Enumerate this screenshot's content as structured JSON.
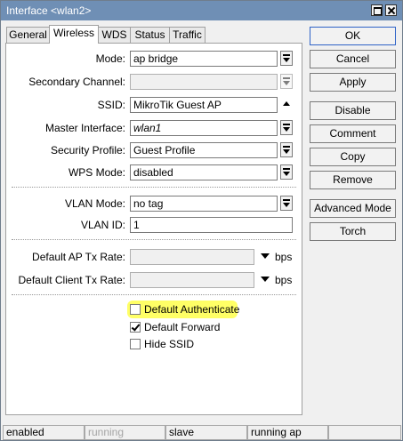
{
  "window": {
    "title": "Interface <wlan2>"
  },
  "tabs": [
    "General",
    "Wireless",
    "WDS",
    "Status",
    "Traffic"
  ],
  "form": {
    "mode": {
      "label": "Mode:",
      "value": "ap bridge"
    },
    "secondary_channel": {
      "label": "Secondary Channel:",
      "value": ""
    },
    "ssid": {
      "label": "SSID:",
      "value": "MikroTik Guest AP"
    },
    "master_interface": {
      "label": "Master Interface:",
      "value": "wlan1"
    },
    "security_profile": {
      "label": "Security Profile:",
      "value": "Guest Profile"
    },
    "wps_mode": {
      "label": "WPS Mode:",
      "value": "disabled"
    },
    "vlan_mode": {
      "label": "VLAN Mode:",
      "value": "no tag"
    },
    "vlan_id": {
      "label": "VLAN ID:",
      "value": "1"
    },
    "default_ap_tx_rate": {
      "label": "Default AP Tx Rate:",
      "value": "",
      "unit": "bps"
    },
    "default_client_tx_rate": {
      "label": "Default Client Tx Rate:",
      "value": "",
      "unit": "bps"
    }
  },
  "checkboxes": [
    {
      "label": "Default Authenticate",
      "checked": false,
      "highlighted": true
    },
    {
      "label": "Default Forward",
      "checked": true
    },
    {
      "label": "Hide SSID",
      "checked": false
    }
  ],
  "buttons": [
    "OK",
    "Cancel",
    "Apply",
    "Disable",
    "Comment",
    "Copy",
    "Remove",
    "Advanced Mode",
    "Torch"
  ],
  "status": [
    "enabled",
    "running",
    "slave",
    "running ap"
  ],
  "colors": {
    "title_bar": "#6f8fb5",
    "highlight": "#ffff66",
    "default_button_border": "#2f63c7"
  }
}
